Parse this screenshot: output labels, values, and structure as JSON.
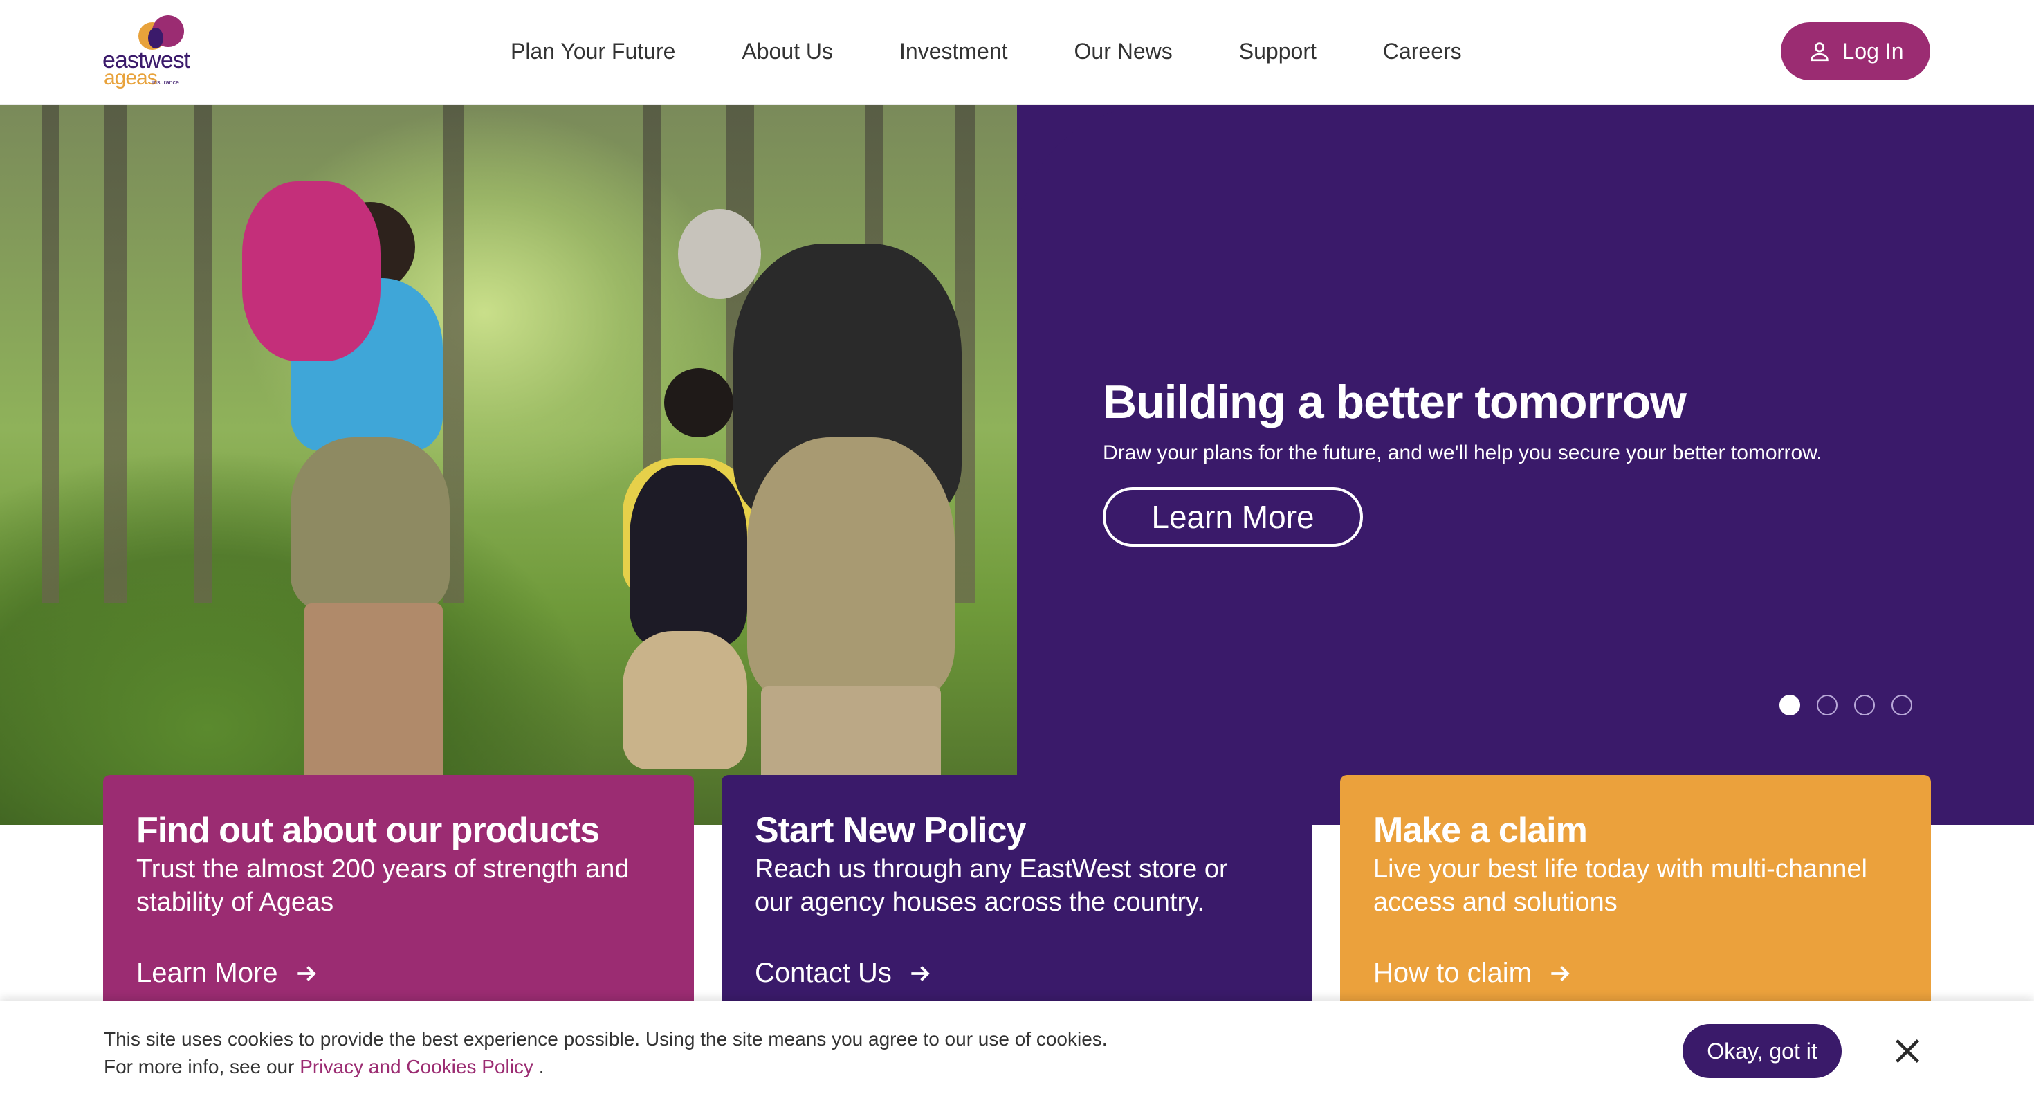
{
  "brand": {
    "line1": "eastwest",
    "line2": "ageas",
    "line3": "insurance",
    "colors": {
      "purple": "#3a1a6a",
      "magenta": "#9b2c72",
      "orange": "#eba13c"
    }
  },
  "nav": {
    "items": [
      {
        "label": "Plan Your Future"
      },
      {
        "label": "About Us"
      },
      {
        "label": "Investment"
      },
      {
        "label": "Our News"
      },
      {
        "label": "Support"
      },
      {
        "label": "Careers"
      }
    ]
  },
  "login": {
    "label": "Log In",
    "icon": "user-icon"
  },
  "hero": {
    "title": "Building a better tomorrow",
    "subtitle": "Draw your plans for the future, and we'll help you secure your better tomorrow.",
    "cta": "Learn More",
    "slides": 4,
    "active_slide": 1
  },
  "cards": [
    {
      "title": "Find out about our products",
      "text": "Trust the almost 200 years of strength and stability of Ageas",
      "link": "Learn More",
      "color": "#9b2c72"
    },
    {
      "title": "Start New Policy",
      "text": "Reach us through any EastWest store or our agency houses across the country.",
      "link": "Contact Us",
      "color": "#3a1a6a"
    },
    {
      "title": "Make a claim",
      "text": "Live your best life today with multi-channel access and solutions",
      "link": "How to claim",
      "color": "#eba13c"
    }
  ],
  "cookie": {
    "line1": "This site uses cookies to provide the best experience possible. Using the site means you agree to our use of cookies.",
    "line2_prefix": "For more info, see our",
    "policy_link": "Privacy and Cookies Policy",
    "line2_suffix": ".",
    "ok": "Okay, got it",
    "close_icon": "close-icon"
  }
}
